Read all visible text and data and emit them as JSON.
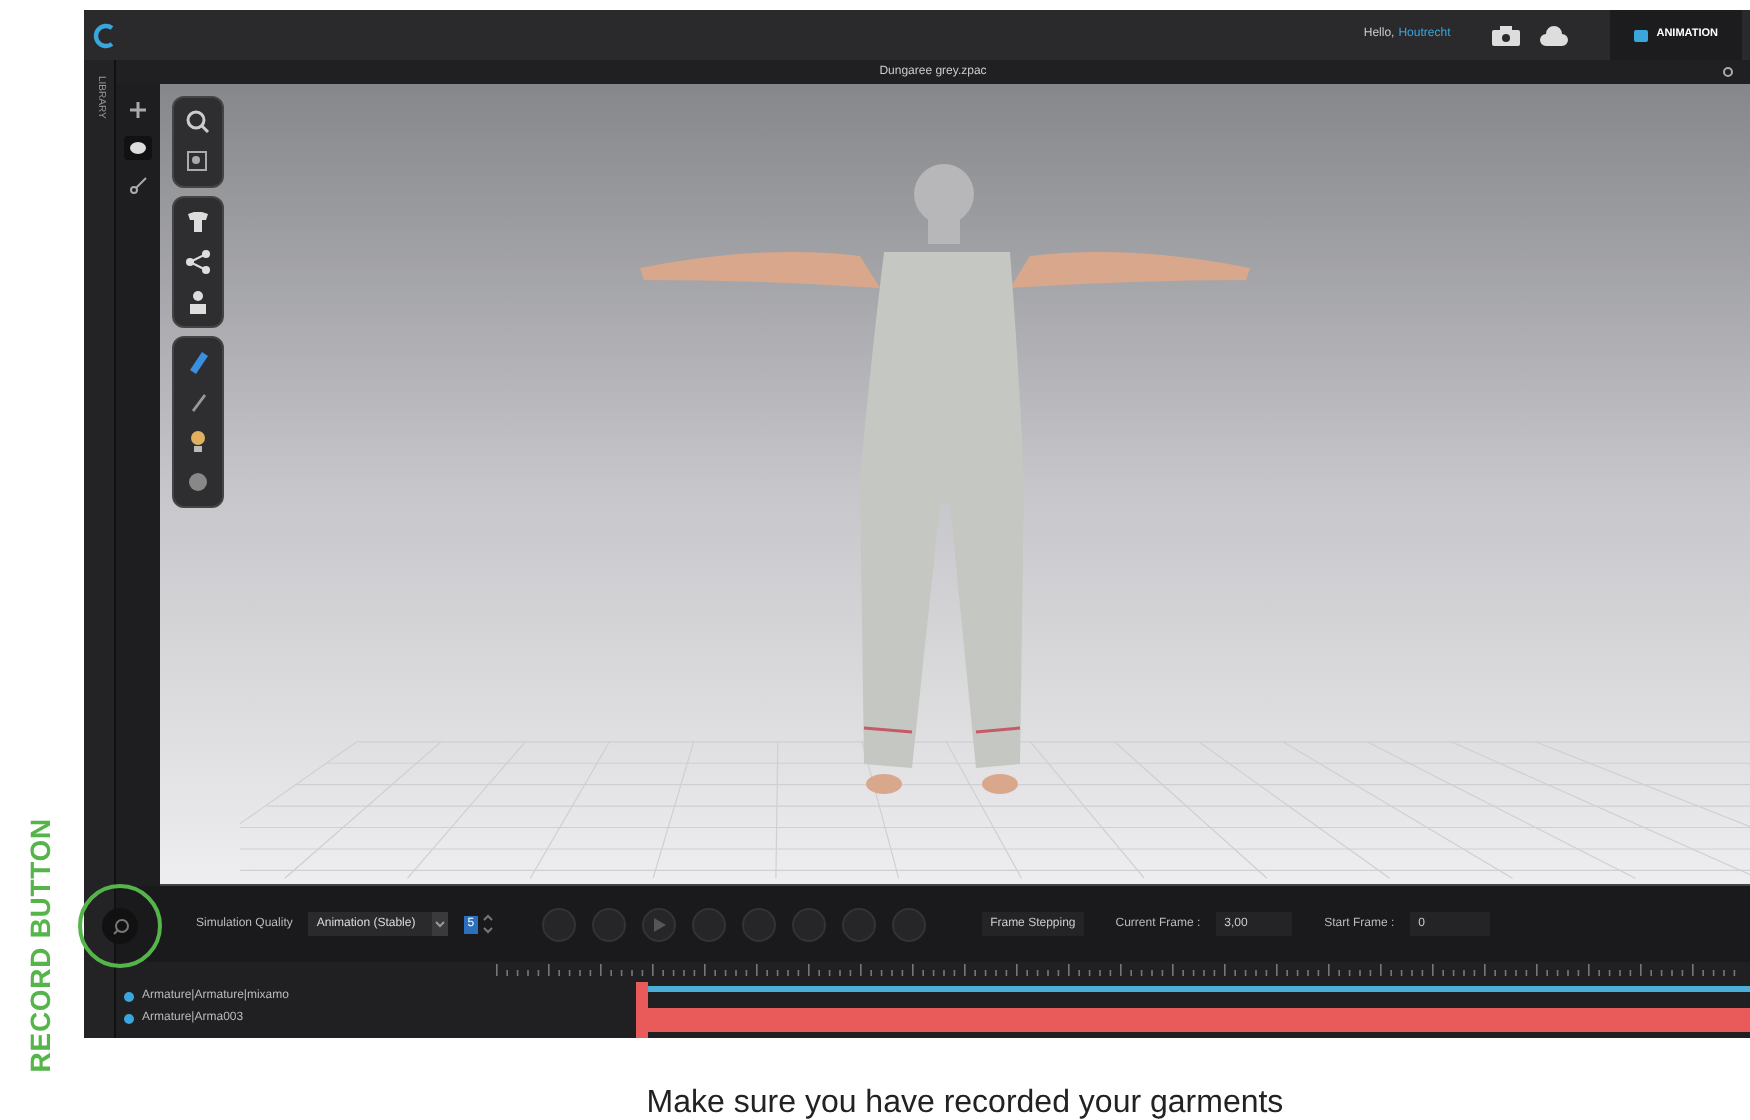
{
  "page": {
    "side_label": "RECORD BUTTON",
    "caption": "Make sure you have recorded your garments"
  },
  "app": {
    "header": {
      "greeting": "Hello,",
      "user": "Houtrecht",
      "mode_tab": "ANIMATION"
    },
    "document_title": "Dungaree grey.zpac",
    "library_label": "LIBRARY",
    "toolbar": {
      "quality_label": "Simulation Quality",
      "quality_value": "Animation (Stable)",
      "step_value": "5",
      "stepping_value": "Frame Stepping",
      "current_frame_label": "Current Frame :",
      "current_frame_value": "3,00",
      "start_frame_label": "Start Frame :",
      "start_frame_value": "0"
    },
    "tracks": [
      {
        "name": "Armature|Armature|mixamo"
      },
      {
        "name": "Armature|Arma003"
      }
    ]
  }
}
